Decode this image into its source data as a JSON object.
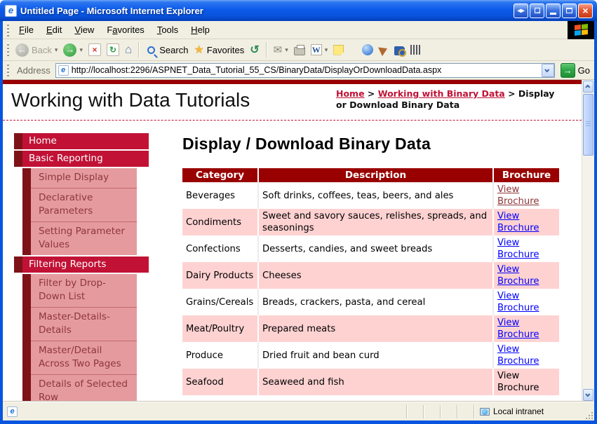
{
  "window": {
    "title": "Untitled Page - Microsoft Internet Explorer"
  },
  "icons": {
    "ie_logo": "e",
    "title_arrows": "◂▸",
    "popout_arrow": "→",
    "close": "×",
    "back": "←",
    "forward": "→",
    "stop": "×",
    "refresh": "↻",
    "home": "⌂",
    "favorites_star": "★",
    "history": "↺",
    "mail": "✉",
    "word": "W",
    "dropdown": "▾",
    "go_arrow": "→"
  },
  "menu_bar": {
    "items": [
      {
        "label": "File",
        "u": 0
      },
      {
        "label": "Edit",
        "u": 0
      },
      {
        "label": "View",
        "u": 0
      },
      {
        "label": "Favorites",
        "u": 1
      },
      {
        "label": "Tools",
        "u": 0
      },
      {
        "label": "Help",
        "u": 0
      }
    ]
  },
  "toolbar": {
    "back_label": "Back",
    "search_label": "Search",
    "favorites_label": "Favorites"
  },
  "address_bar": {
    "label": "Address",
    "url": "http://localhost:2296/ASPNET_Data_Tutorial_55_CS/BinaryData/DisplayOrDownloadData.aspx",
    "go_label": "Go"
  },
  "page": {
    "site_title": "Working with Data Tutorials",
    "breadcrumb": [
      {
        "label": "Home",
        "type": "link"
      },
      {
        "label": " > ",
        "type": "sep"
      },
      {
        "label": "Working with Binary Data",
        "type": "link"
      },
      {
        "label": " > ",
        "type": "sep"
      },
      {
        "label": "Display or Download Binary Data",
        "type": "text"
      }
    ],
    "sidebar": {
      "items": [
        {
          "label": "Home",
          "level": 1
        },
        {
          "label": "Basic Reporting",
          "level": 1
        },
        {
          "label": "Simple Display",
          "level": 2
        },
        {
          "label": "Declarative Parameters",
          "level": 2
        },
        {
          "label": "Setting Parameter Values",
          "level": 2
        },
        {
          "label": "Filtering Reports",
          "level": 1
        },
        {
          "label": "Filter by Drop-Down List",
          "level": 2
        },
        {
          "label": "Master-Details-Details",
          "level": 2
        },
        {
          "label": "Master/Detail Across Two Pages",
          "level": 2
        },
        {
          "label": "Details of Selected Row",
          "level": 2
        },
        {
          "label": "",
          "level": 1,
          "partial": true
        }
      ]
    },
    "main": {
      "heading": "Display / Download Binary Data",
      "table": {
        "headers": [
          "Category",
          "Description",
          "Brochure"
        ],
        "rows": [
          {
            "category": "Beverages",
            "description": "Soft drinks, coffees, teas, beers, and ales",
            "brochure": "View Brochure",
            "link_style": "visited"
          },
          {
            "category": "Condiments",
            "description": "Sweet and savory sauces, relishes, spreads, and seasonings",
            "brochure": "View Brochure",
            "link_style": "link"
          },
          {
            "category": "Confections",
            "description": "Desserts, candies, and sweet breads",
            "brochure": "View Brochure",
            "link_style": "link"
          },
          {
            "category": "Dairy Products",
            "description": "Cheeses",
            "brochure": "View Brochure",
            "link_style": "link"
          },
          {
            "category": "Grains/Cereals",
            "description": "Breads, crackers, pasta, and cereal",
            "brochure": "View Brochure",
            "link_style": "link"
          },
          {
            "category": "Meat/Poultry",
            "description": "Prepared meats",
            "brochure": "View Brochure",
            "link_style": "link"
          },
          {
            "category": "Produce",
            "description": "Dried fruit and bean curd",
            "brochure": "View Brochure",
            "link_style": "link"
          },
          {
            "category": "Seafood",
            "description": "Seaweed and fish",
            "brochure": "View Brochure",
            "link_style": "none"
          }
        ]
      }
    }
  },
  "status_bar": {
    "zone": "Local intranet"
  },
  "colors": {
    "crimson": "#C11236",
    "sidebar_accent": "#7D1319",
    "sidebar_sub_bg": "#E59B9E",
    "sidebar_sub_text": "#8E363D",
    "table_header_bg": "#990000",
    "row_alt_bg": "#FFD2D2",
    "link_blue": "#0000FF",
    "link_visited": "#8F3437",
    "titlebar_blue": "#0C5BEA",
    "chrome_bg": "#F1EFE2"
  }
}
